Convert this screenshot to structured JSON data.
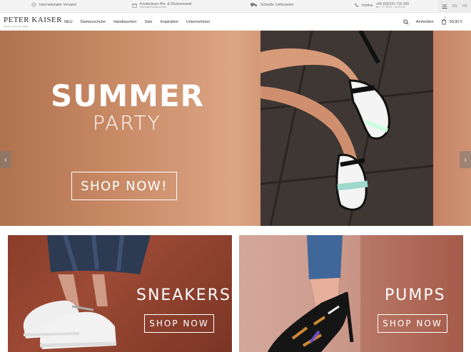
{
  "topbar": {
    "shipping": "Internationaler Versand",
    "returns": "Kostenloser Hin- & Rückversand",
    "returns_sub": "innerhalb Deutschlands",
    "delivery": "Schnelle Lieferzeiten",
    "hotline_label": "Hotline",
    "hotline_number": "+49 (0)6331 716 305",
    "hotline_hours": "Mo. - Fr. 09:00 - 16:00 Uhr",
    "languages": [
      "DE",
      "EN",
      "FR"
    ]
  },
  "nav": {
    "logo": "PETER KAISER",
    "logo_sub": "Made in Europe 1838",
    "items": [
      "NEU",
      "Damenschuhe",
      "Handtaschen",
      "Sale",
      "Inspiration",
      "Unternehmen"
    ],
    "login": "Anmelden",
    "cart_count": "0",
    "cart_total": "99,90 €"
  },
  "hero": {
    "title": "SUMMER",
    "subtitle": "PARTY",
    "cta": "SHOP NOW!",
    "prev": "‹",
    "next": "›"
  },
  "tiles": [
    {
      "label": "SNEAKERS",
      "cta": "SHOP NOW"
    },
    {
      "label": "PUMPS",
      "cta": "SHOP NOW"
    }
  ],
  "colors": {
    "hero_bg": "#c98a66",
    "floor": "#3f3733",
    "sneakers_bg": "#8a3d2a",
    "pumps_bg": "#b67463"
  }
}
